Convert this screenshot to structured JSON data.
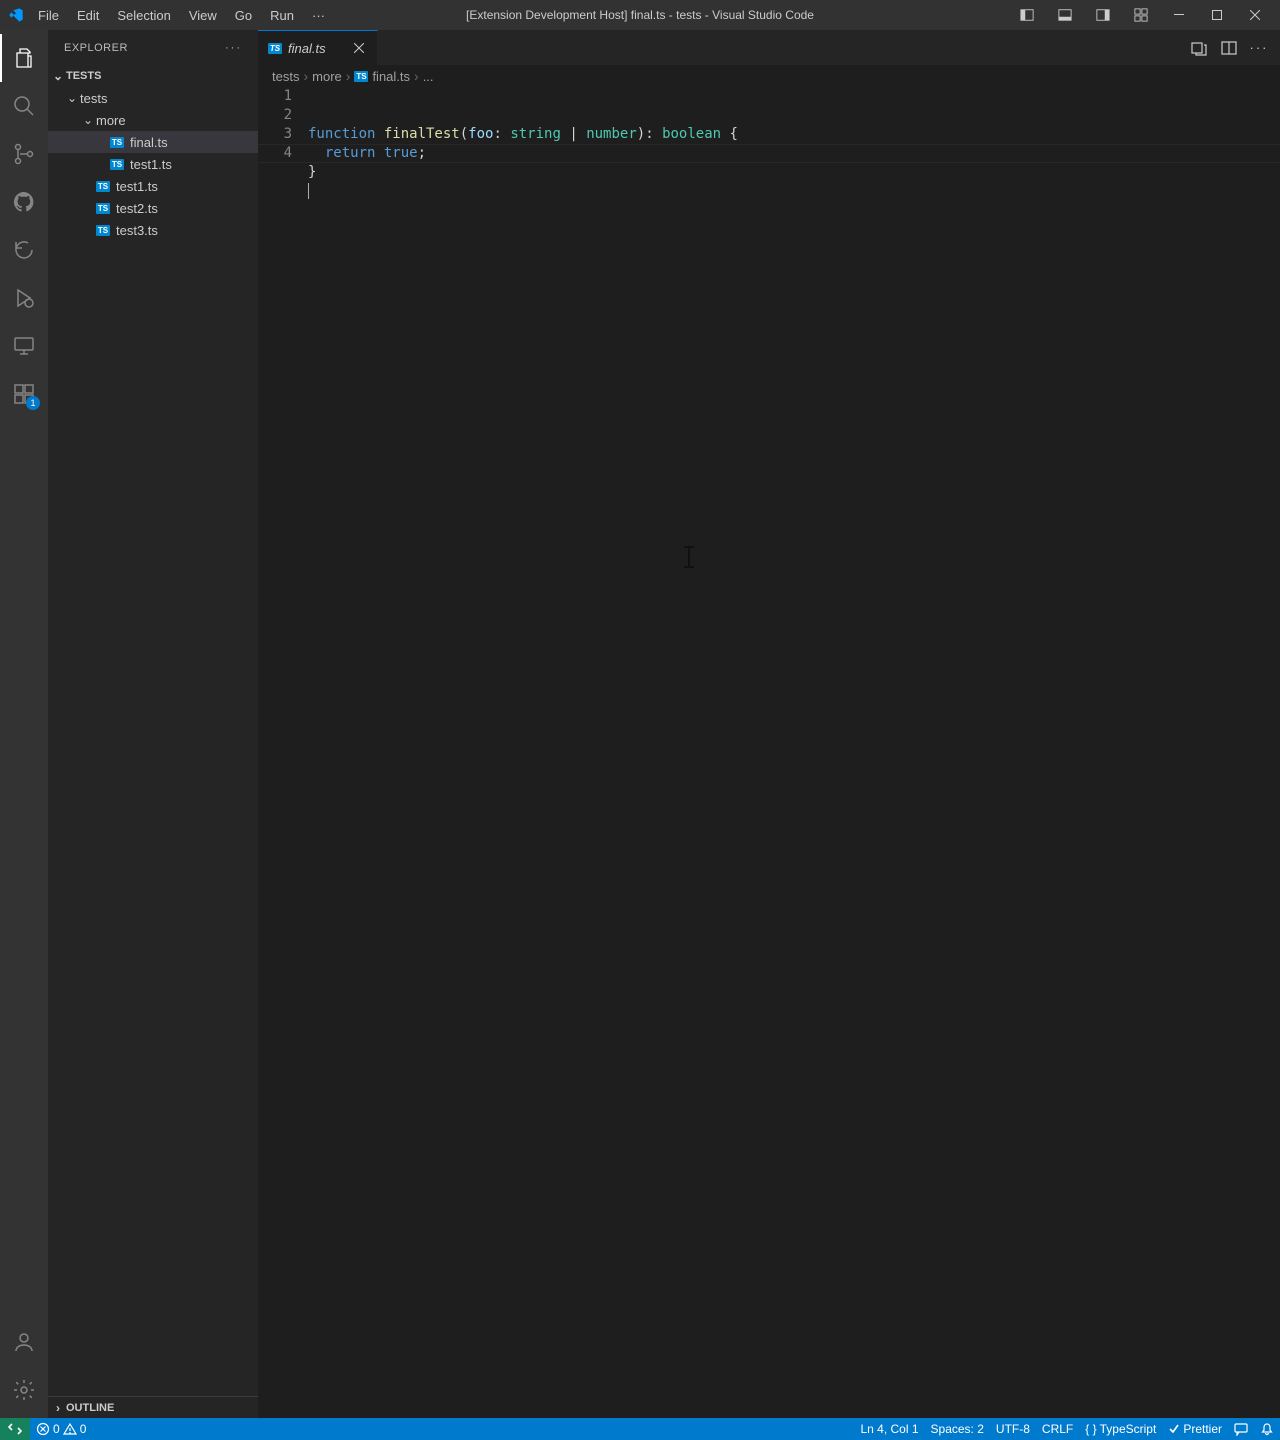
{
  "titlebar": {
    "menus": [
      "File",
      "Edit",
      "Selection",
      "View",
      "Go",
      "Run"
    ],
    "more_label": "···",
    "title": "[Extension Development Host] final.ts - tests - Visual Studio Code"
  },
  "activity": {
    "items": [
      {
        "name": "explorer",
        "active": true
      },
      {
        "name": "search"
      },
      {
        "name": "source-control"
      },
      {
        "name": "github"
      },
      {
        "name": "timeline"
      },
      {
        "name": "run-debug"
      },
      {
        "name": "remote-explorer"
      },
      {
        "name": "extensions",
        "badge": "1"
      }
    ],
    "bottom": [
      {
        "name": "accounts"
      },
      {
        "name": "settings-gear"
      }
    ]
  },
  "sidebar": {
    "title": "EXPLORER",
    "root": "TESTS",
    "tree": [
      {
        "type": "folder",
        "label": "tests",
        "depth": 1,
        "expanded": true
      },
      {
        "type": "folder",
        "label": "more",
        "depth": 2,
        "expanded": true
      },
      {
        "type": "file",
        "label": "final.ts",
        "depth": 3,
        "icon": "TS",
        "active": true
      },
      {
        "type": "file",
        "label": "test1.ts",
        "depth": 3,
        "icon": "TS"
      },
      {
        "type": "file",
        "label": "test1.ts",
        "depth": 2,
        "icon": "TS"
      },
      {
        "type": "file",
        "label": "test2.ts",
        "depth": 2,
        "icon": "TS"
      },
      {
        "type": "file",
        "label": "test3.ts",
        "depth": 2,
        "icon": "TS"
      }
    ],
    "outline_label": "OUTLINE"
  },
  "tabs": {
    "open": [
      {
        "icon": "TS",
        "label": "final.ts",
        "italic": true
      }
    ]
  },
  "breadcrumbs": {
    "parts": [
      "tests",
      "more"
    ],
    "file_icon": "TS",
    "file": "final.ts",
    "symbol": "..."
  },
  "code": {
    "line_numbers": [
      "1",
      "2",
      "3",
      "4"
    ],
    "tokens": [
      [
        {
          "t": "function ",
          "c": "tok-kw"
        },
        {
          "t": "finalTest",
          "c": "tok-fn"
        },
        {
          "t": "(",
          "c": "tok-punc"
        },
        {
          "t": "foo",
          "c": "tok-var"
        },
        {
          "t": ": ",
          "c": "tok-punc"
        },
        {
          "t": "string",
          "c": "tok-type"
        },
        {
          "t": " | ",
          "c": "tok-punc"
        },
        {
          "t": "number",
          "c": "tok-type"
        },
        {
          "t": "): ",
          "c": "tok-punc"
        },
        {
          "t": "boolean",
          "c": "tok-type"
        },
        {
          "t": " {",
          "c": "tok-punc"
        }
      ],
      [
        {
          "t": "  ",
          "c": ""
        },
        {
          "t": "return ",
          "c": "tok-kw"
        },
        {
          "t": "true",
          "c": "tok-bool"
        },
        {
          "t": ";",
          "c": "tok-punc"
        }
      ],
      [
        {
          "t": "}",
          "c": "tok-punc"
        }
      ],
      []
    ],
    "cursor_line": 4
  },
  "status": {
    "errors": "0",
    "warnings": "0",
    "cursor": "Ln 4, Col 1",
    "spaces": "Spaces: 2",
    "encoding": "UTF-8",
    "eol": "CRLF",
    "language": "TypeScript",
    "prettier": "Prettier"
  }
}
